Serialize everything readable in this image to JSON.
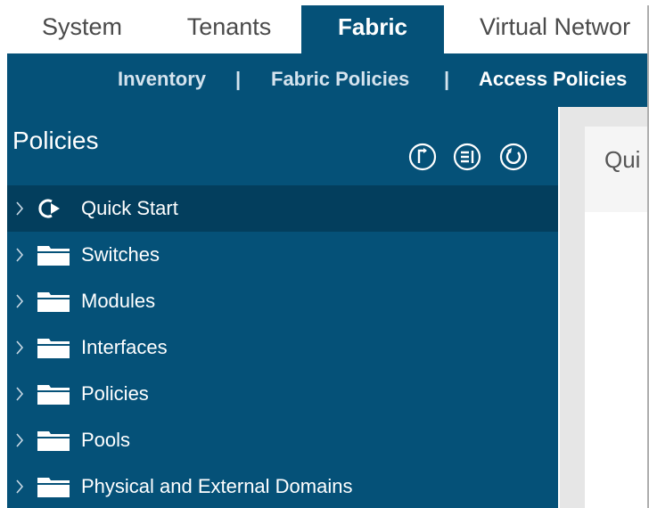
{
  "top_tabs": [
    {
      "label": "System",
      "active": false
    },
    {
      "label": "Tenants",
      "active": false
    },
    {
      "label": "Fabric",
      "active": true
    },
    {
      "label": "Virtual Networ",
      "active": false
    }
  ],
  "sub_nav": {
    "items": [
      "Inventory",
      "Fabric Policies",
      "Access Policies"
    ],
    "separator": "|",
    "active": "Access Policies"
  },
  "sidebar": {
    "title": "Policies",
    "tools": [
      "tree-filter-icon",
      "collapse-list-icon",
      "refresh-icon"
    ],
    "items": [
      {
        "label": "Quick Start",
        "icon": "play-icon",
        "selected": true
      },
      {
        "label": "Switches",
        "icon": "folder-icon"
      },
      {
        "label": "Modules",
        "icon": "folder-icon"
      },
      {
        "label": "Interfaces",
        "icon": "folder-icon"
      },
      {
        "label": "Policies",
        "icon": "folder-icon"
      },
      {
        "label": "Pools",
        "icon": "folder-icon"
      },
      {
        "label": "Physical and External Domains",
        "icon": "folder-icon"
      }
    ]
  },
  "main": {
    "panel_title": "Qui"
  },
  "colors": {
    "nav_blue": "#055178",
    "selected_row": "#033e5d",
    "text_white": "#ffffff"
  }
}
